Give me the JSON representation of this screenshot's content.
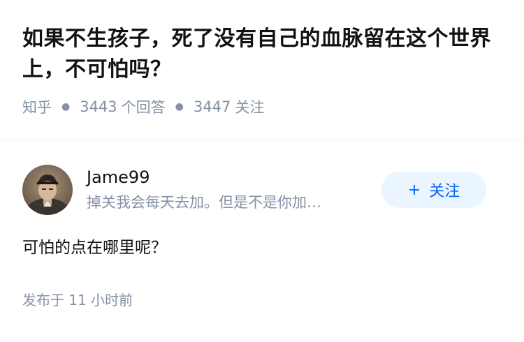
{
  "question": {
    "title": "如果不生孩子，死了没有自己的血脉留在这个世界上，不可怕吗？",
    "source": "知乎",
    "answer_count": "3443",
    "answer_unit": "个回答",
    "follower_count": "3447",
    "follower_unit": "关注"
  },
  "answer": {
    "author_name": "Jame99",
    "author_bio": "掉关我会每天去加。但是不是你加…",
    "follow_label": "关注",
    "follow_icon": "plus-icon",
    "content": "可怕的点在哪里呢？",
    "published_label": "发布于",
    "published_time": "11 小时前"
  },
  "colors": {
    "title": "#121212",
    "meta": "#8590a6",
    "accent": "#0066ff",
    "follow_bg": "#ebf5ff"
  }
}
